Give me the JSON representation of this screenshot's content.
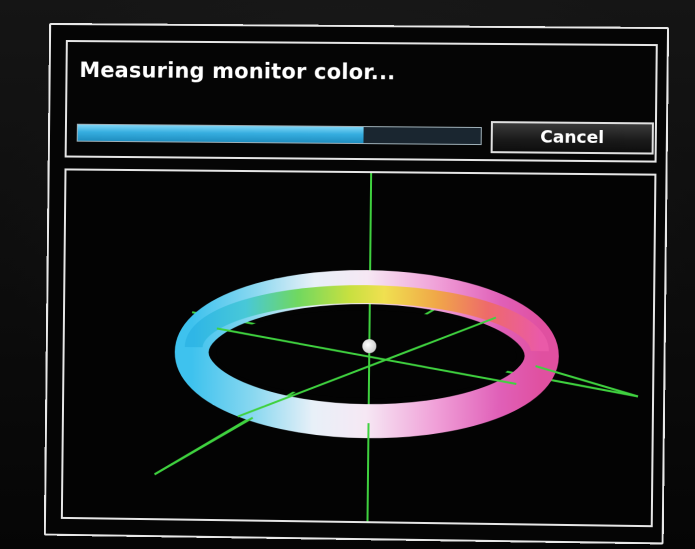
{
  "dialog": {
    "title": "Measuring monitor color...",
    "progress": 0.71,
    "cancel_label": "Cancel"
  },
  "colors": {
    "axis": "#3fd13f",
    "progress": "#3ab2e4",
    "frame": "#e8e8e8",
    "background": "#050505"
  },
  "visualization": {
    "icon": "color-wheel-3d",
    "hue_stops": [
      "#3cc8e8",
      "#60e0a0",
      "#a8e040",
      "#f0e040",
      "#f0a040",
      "#f06070",
      "#f060b0",
      "#f0c0e0",
      "#ffffff",
      "#a0e0f0"
    ]
  }
}
